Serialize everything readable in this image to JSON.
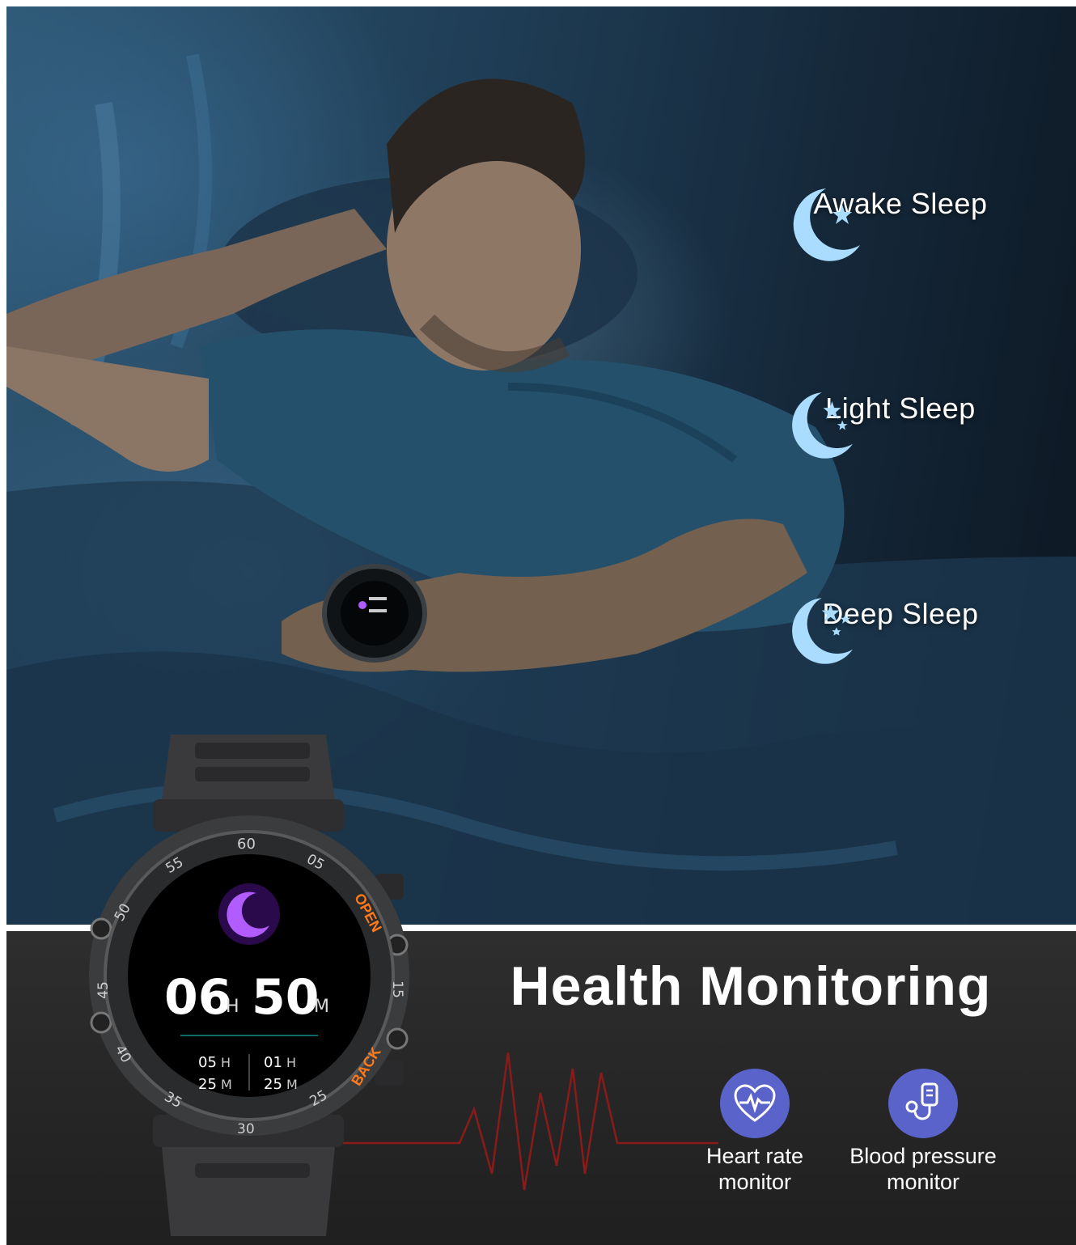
{
  "sleep_stages": [
    {
      "label": "Awake Sleep",
      "icon": "moon-star-icon"
    },
    {
      "label": "Light Sleep",
      "icon": "moon-two-stars-icon"
    },
    {
      "label": "Deep Sleep",
      "icon": "moon-three-stars-icon"
    }
  ],
  "headline": "Health Monitoring",
  "features": [
    {
      "label_line1": "Heart rate",
      "label_line2": "monitor",
      "icon": "heart-pulse-icon"
    },
    {
      "label_line1": "Blood pressure",
      "label_line2": "monitor",
      "icon": "stethoscope-icon"
    }
  ],
  "watch": {
    "bezel_numbers": [
      "60",
      "05",
      "15",
      "25",
      "30",
      "35",
      "40",
      "45",
      "50",
      "55"
    ],
    "button_labels": {
      "open": "OPEN",
      "back": "BACK"
    },
    "total_hours": "06",
    "total_minutes": "50",
    "hour_unit": "H",
    "minute_unit": "M",
    "left_stat": {
      "hours": "05",
      "minutes": "25"
    },
    "right_stat": {
      "hours": "01",
      "minutes": "25"
    }
  },
  "colors": {
    "icon_blue": "#a9dcff",
    "badge_purple": "#5a63c9",
    "accent_orange": "#ff7a1a",
    "moon_purple": "#b05cff"
  }
}
